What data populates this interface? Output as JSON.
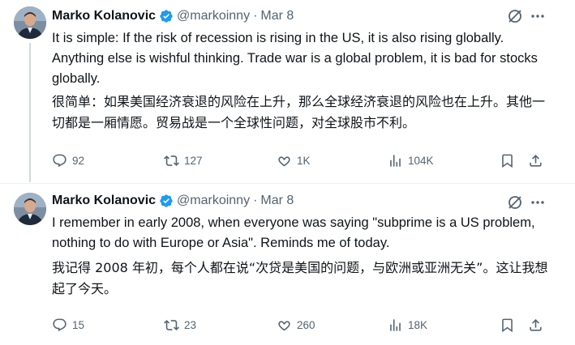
{
  "tweets": [
    {
      "name": "Marko Kolanovic",
      "handle": "@markoinny",
      "separator": "·",
      "date": "Mar 8",
      "text_en": "It is simple: If the risk of recession is rising in the US, it is also rising globally. Anything else is wishful thinking. Trade war is a global problem, it is bad for stocks globally.",
      "text_zh": "很简单：如果美国经济衰退的风险在上升，那么全球经济衰退的风险也在上升。其他一切都是一厢情愿。贸易战是一个全球性问题，对全球股市不利。",
      "replies": "92",
      "retweets": "127",
      "likes": "1K",
      "views": "104K"
    },
    {
      "name": "Marko Kolanovic",
      "handle": "@markoinny",
      "separator": "·",
      "date": "Mar 8",
      "text_en": "I remember in early 2008, when everyone was saying \"subprime is a US problem, nothing to do with Europe or Asia\". Reminds me of today.",
      "text_zh": "我记得 2008 年初，每个人都在说“次贷是美国的问题，与欧洲或亚洲无关”。这让我想起了今天。",
      "replies": "15",
      "retweets": "23",
      "likes": "260",
      "views": "18K"
    }
  ],
  "icons": {
    "verified": "verified-badge-icon",
    "grok": "grok-icon",
    "more": "more-icon",
    "reply": "reply-icon",
    "retweet": "retweet-icon",
    "like": "like-icon",
    "views": "views-icon",
    "bookmark": "bookmark-icon",
    "share": "share-icon"
  },
  "colors": {
    "text": "#0f1419",
    "secondary": "#536471",
    "verified": "#1d9bf0",
    "thread_line": "#cfd9de"
  }
}
